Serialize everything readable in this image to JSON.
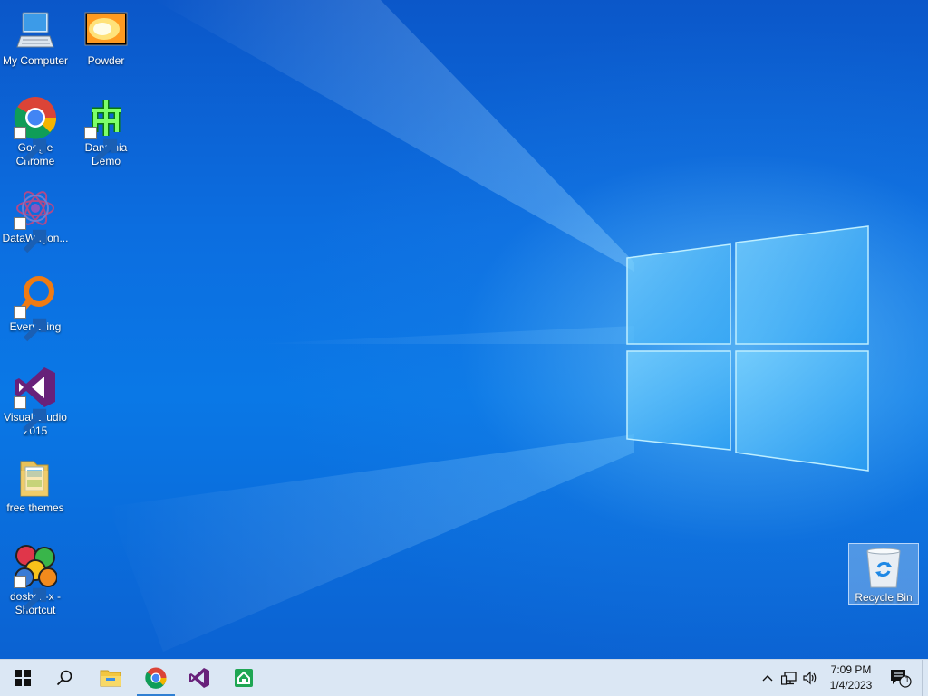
{
  "desktop": {
    "icons": [
      {
        "label": "My Computer",
        "icon": "computer-icon"
      },
      {
        "label": "Powder",
        "icon": "powder-icon"
      },
      {
        "label": "Google Chrome",
        "icon": "chrome-icon",
        "shortcut": true
      },
      {
        "label": "Darwinia Demo",
        "icon": "darwinia-icon",
        "shortcut": true
      },
      {
        "label": "DataWagon...",
        "icon": "datawagon-icon",
        "shortcut": true
      },
      {
        "label": "Everything",
        "icon": "everything-search-icon",
        "shortcut": true
      },
      {
        "label": "Visual Studio 2015",
        "icon": "visual-studio-icon",
        "shortcut": true
      },
      {
        "label": "free themes",
        "icon": "folder-icon"
      },
      {
        "label": "dosbox-x - Shortcut",
        "icon": "dosbox-icon",
        "shortcut": true
      },
      {
        "label": "Recycle Bin",
        "icon": "recycle-bin-icon",
        "selected": true
      }
    ]
  },
  "taskbar": {
    "start": "windows-start-icon",
    "search": "search-icon",
    "pinned": [
      {
        "name": "File Explorer",
        "icon": "file-explorer-icon"
      },
      {
        "name": "Google Chrome",
        "icon": "chrome-icon",
        "active": true
      },
      {
        "name": "Visual Studio",
        "icon": "visual-studio-icon"
      },
      {
        "name": "Green house app",
        "icon": "green-house-icon"
      }
    ],
    "tray": {
      "time": "7:09 PM",
      "date": "1/4/2023",
      "notification_count": "1"
    }
  },
  "colors": {
    "taskbar_bg": "#dbe7f4",
    "accent": "#2f7fd3"
  }
}
